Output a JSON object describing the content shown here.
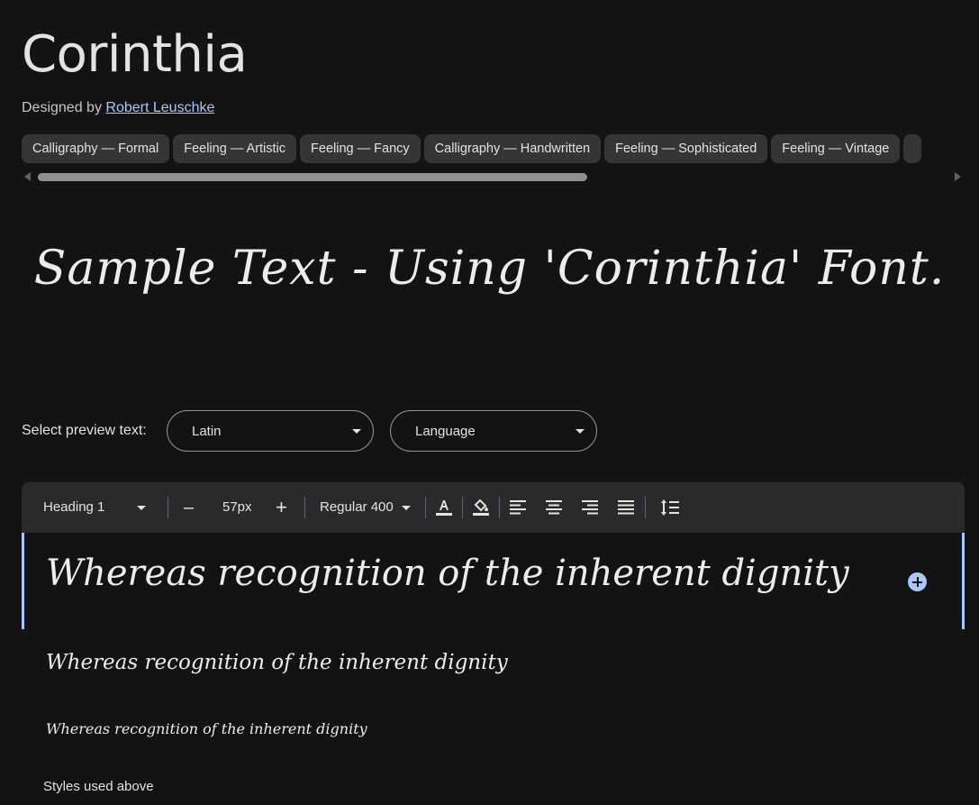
{
  "font": {
    "name": "Corinthia",
    "designer_prefix": "Designed by",
    "designer_name": "Robert Leuschke"
  },
  "tags": [
    "Calligraphy — Formal",
    "Feeling — Artistic",
    "Feeling — Fancy",
    "Calligraphy — Handwritten",
    "Feeling — Sophisticated",
    "Feeling — Vintage"
  ],
  "sample_text": "Sample Text - Using 'Corinthia' Font.",
  "preview": {
    "label": "Select preview text:",
    "script_select": "Latin",
    "language_select": "Language"
  },
  "toolbar": {
    "style": "Heading 1",
    "size": "57px",
    "weight": "Regular 400",
    "minus": "–",
    "plus": "+"
  },
  "preview_lines": [
    "Whereas recognition of the inherent dignity",
    "Whereas recognition of the inherent dignity",
    "Whereas recognition of the inherent dignity"
  ],
  "styles_used_label": "Styles used above",
  "colors": {
    "background": "#131314",
    "chip": "#333537",
    "toolbar": "#282a2c",
    "accent": "#a8c7fa",
    "text": "#e3e3e3"
  }
}
